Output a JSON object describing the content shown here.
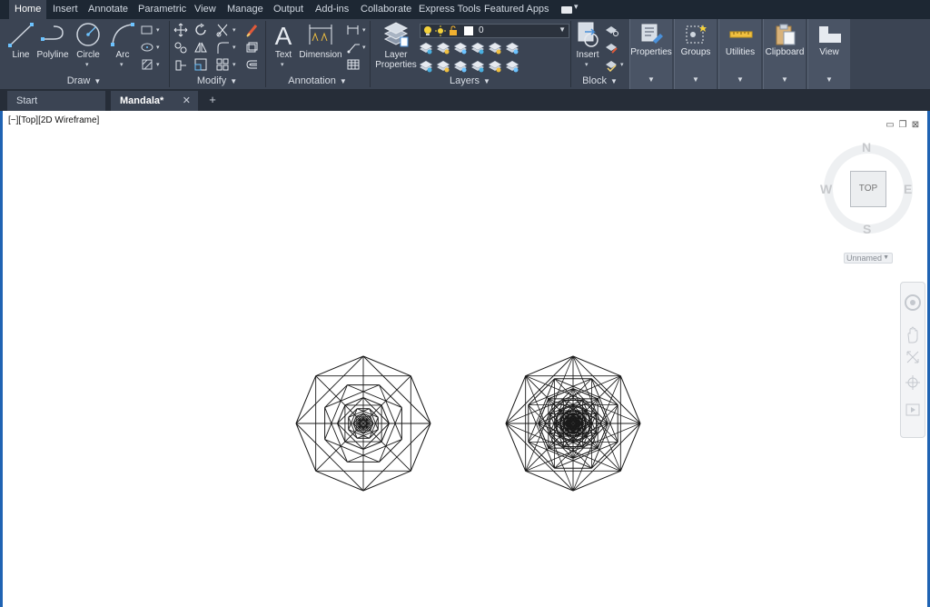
{
  "ribbon_tabs": [
    {
      "label": "Home",
      "active": true
    },
    {
      "label": "Insert"
    },
    {
      "label": "Annotate"
    },
    {
      "label": "Parametric"
    },
    {
      "label": "View"
    },
    {
      "label": "Manage"
    },
    {
      "label": "Output"
    },
    {
      "label": "Add-ins"
    },
    {
      "label": "Collaborate"
    },
    {
      "label": "Express Tools"
    },
    {
      "label": "Featured Apps"
    }
  ],
  "panels": {
    "draw": {
      "title": "Draw",
      "tools": {
        "line": "Line",
        "polyline": "Polyline",
        "circle": "Circle",
        "arc": "Arc"
      }
    },
    "modify": {
      "title": "Modify"
    },
    "annotation": {
      "title": "Annotation",
      "tools": {
        "text": "Text",
        "dimension": "Dimension"
      }
    },
    "layers": {
      "title": "Layers",
      "layer_properties_line1": "Layer",
      "layer_properties_line2": "Properties",
      "current_layer": "0"
    },
    "block": {
      "title": "Block",
      "insert": "Insert"
    },
    "properties": {
      "label": "Properties"
    },
    "groups": {
      "label": "Groups"
    },
    "utilities": {
      "label": "Utilities"
    },
    "clipboard": {
      "label": "Clipboard"
    },
    "view": {
      "label": "View"
    }
  },
  "file_tabs": {
    "start": "Start",
    "active": "Mandala*",
    "close_glyph": "✕",
    "new_tab_glyph": "+"
  },
  "viewport": {
    "label": "[−][Top][2D Wireframe]",
    "viewcube": {
      "n": "N",
      "s": "S",
      "e": "E",
      "w": "W",
      "face": "TOP"
    },
    "ucs": "Unnamed"
  },
  "colors": {
    "ribbon_bg": "#3b4453",
    "tabbar_bg": "#1d2733",
    "viewport_border": "#1f63b3",
    "drawing_stroke": "#1a1a1a"
  },
  "icons": [
    "line-icon",
    "polyline-icon",
    "circle-icon",
    "arc-icon",
    "text-icon",
    "dimension-icon",
    "layer-properties-icon",
    "insert-block-icon",
    "properties-icon",
    "groups-icon",
    "utilities-icon",
    "clipboard-icon",
    "view-icon",
    "steering-wheel-icon",
    "pan-icon",
    "zoom-icon",
    "orbit-icon",
    "showmotion-icon"
  ]
}
